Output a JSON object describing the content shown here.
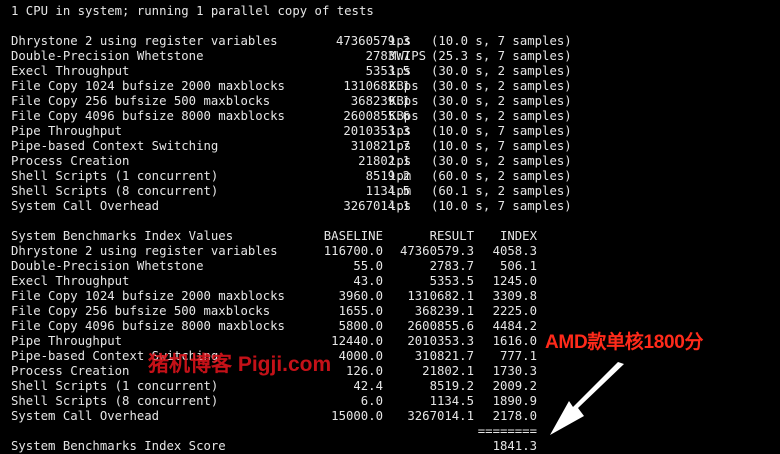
{
  "header_line": "1 CPU in system; running 1 parallel copy of tests",
  "performance": [
    {
      "name": "Dhrystone 2 using register variables",
      "value": "47360579.3",
      "unit": "lps",
      "detail": "(10.0 s, 7 samples)"
    },
    {
      "name": "Double-Precision Whetstone",
      "value": "2783.7",
      "unit": "MWIPS",
      "detail": "(25.3 s, 7 samples)"
    },
    {
      "name": "Execl Throughput",
      "value": "5353.5",
      "unit": "lps",
      "detail": "(30.0 s, 2 samples)"
    },
    {
      "name": "File Copy 1024 bufsize 2000 maxblocks",
      "value": "1310682.1",
      "unit": "KBps",
      "detail": "(30.0 s, 2 samples)"
    },
    {
      "name": "File Copy 256 bufsize 500 maxblocks",
      "value": "368239.1",
      "unit": "KBps",
      "detail": "(30.0 s, 2 samples)"
    },
    {
      "name": "File Copy 4096 bufsize 8000 maxblocks",
      "value": "2600855.6",
      "unit": "KBps",
      "detail": "(30.0 s, 2 samples)"
    },
    {
      "name": "Pipe Throughput",
      "value": "2010353.3",
      "unit": "lps",
      "detail": "(10.0 s, 7 samples)"
    },
    {
      "name": "Pipe-based Context Switching",
      "value": "310821.7",
      "unit": "lps",
      "detail": "(10.0 s, 7 samples)"
    },
    {
      "name": "Process Creation",
      "value": "21802.1",
      "unit": "lps",
      "detail": "(30.0 s, 2 samples)"
    },
    {
      "name": "Shell Scripts (1 concurrent)",
      "value": "8519.2",
      "unit": "lpm",
      "detail": "(60.0 s, 2 samples)"
    },
    {
      "name": "Shell Scripts (8 concurrent)",
      "value": "1134.5",
      "unit": "lpm",
      "detail": "(60.1 s, 2 samples)"
    },
    {
      "name": "System Call Overhead",
      "value": "3267014.1",
      "unit": "lps",
      "detail": "(10.0 s, 7 samples)"
    }
  ],
  "index_table": {
    "title": "System Benchmarks Index Values",
    "col_baseline": "BASELINE",
    "col_result": "RESULT",
    "col_index": "INDEX",
    "rows": [
      {
        "name": "Dhrystone 2 using register variables",
        "baseline": "116700.0",
        "result": "47360579.3",
        "index": "4058.3"
      },
      {
        "name": "Double-Precision Whetstone",
        "baseline": "55.0",
        "result": "2783.7",
        "index": "506.1"
      },
      {
        "name": "Execl Throughput",
        "baseline": "43.0",
        "result": "5353.5",
        "index": "1245.0"
      },
      {
        "name": "File Copy 1024 bufsize 2000 maxblocks",
        "baseline": "3960.0",
        "result": "1310682.1",
        "index": "3309.8"
      },
      {
        "name": "File Copy 256 bufsize 500 maxblocks",
        "baseline": "1655.0",
        "result": "368239.1",
        "index": "2225.0"
      },
      {
        "name": "File Copy 4096 bufsize 8000 maxblocks",
        "baseline": "5800.0",
        "result": "2600855.6",
        "index": "4484.2"
      },
      {
        "name": "Pipe Throughput",
        "baseline": "12440.0",
        "result": "2010353.3",
        "index": "1616.0"
      },
      {
        "name": "Pipe-based Context Switching",
        "baseline": "4000.0",
        "result": "310821.7",
        "index": "777.1"
      },
      {
        "name": "Process Creation",
        "baseline": "126.0",
        "result": "21802.1",
        "index": "1730.3"
      },
      {
        "name": "Shell Scripts (1 concurrent)",
        "baseline": "42.4",
        "result": "8519.2",
        "index": "2009.2"
      },
      {
        "name": "Shell Scripts (8 concurrent)",
        "baseline": "6.0",
        "result": "1134.5",
        "index": "1890.9"
      },
      {
        "name": "System Call Overhead",
        "baseline": "15000.0",
        "result": "3267014.1",
        "index": "2178.0"
      }
    ],
    "separator": "========",
    "score_label": "System Benchmarks Index Score",
    "score_value": "1841.3"
  },
  "annotation": {
    "text": "AMD款单核1800分",
    "color": "#ff2a1a"
  },
  "watermark": {
    "text": "猪机博客 Pigji.com",
    "color": "#e0141c"
  },
  "arrow_color": "#ffffff",
  "text_color": "#e6e6e6",
  "background_color": "#000000"
}
